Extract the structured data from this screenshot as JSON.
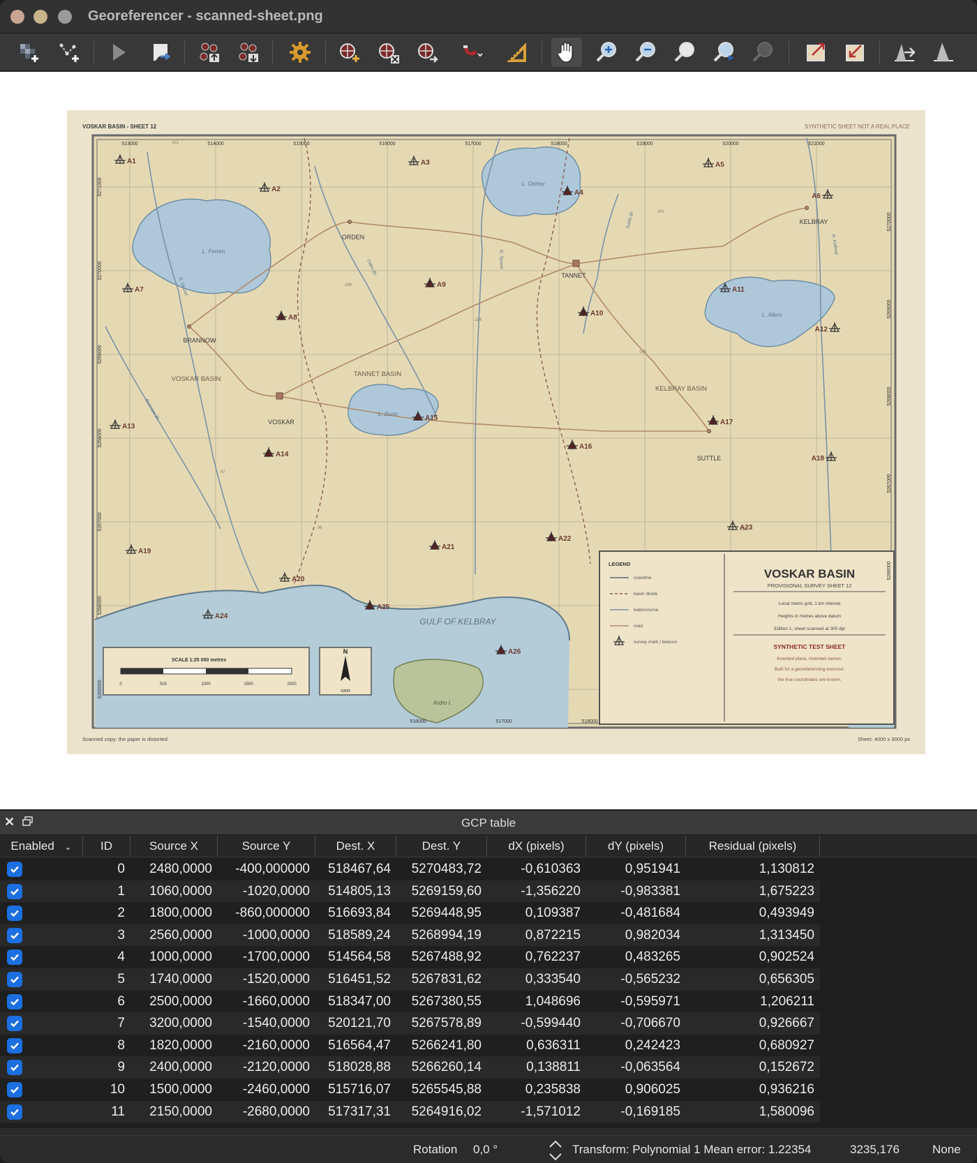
{
  "window": {
    "title": "Georeferencer - scanned-sheet.png"
  },
  "toolbar": {
    "tools": [
      {
        "name": "open-raster-icon"
      },
      {
        "name": "start-georef-icon"
      },
      {
        "name": "run-icon"
      },
      {
        "name": "generate-script-icon"
      },
      {
        "name": "load-gcp-icon"
      },
      {
        "name": "save-gcp-icon"
      },
      {
        "name": "settings-icon"
      },
      {
        "name": "add-point-icon"
      },
      {
        "name": "delete-point-icon"
      },
      {
        "name": "move-point-icon"
      },
      {
        "name": "snap-icon"
      },
      {
        "name": "transform-settings-icon"
      },
      {
        "name": "pan-icon"
      },
      {
        "name": "zoom-in-icon"
      },
      {
        "name": "zoom-out-icon"
      },
      {
        "name": "zoom-layer-icon"
      },
      {
        "name": "zoom-last-icon"
      },
      {
        "name": "zoom-next-icon"
      },
      {
        "name": "link-georef-icon"
      },
      {
        "name": "link-qgis-icon"
      },
      {
        "name": "full-histogram-icon"
      },
      {
        "name": "local-histogram-icon"
      }
    ]
  },
  "map": {
    "header_left": "VOSKAR BASIN - SHEET 12",
    "header_right": "SYNTHETIC SHEET   NOT A REAL PLACE",
    "footer_left": "Scanned copy; the paper is distorted.",
    "footer_right": "Sheet: 4000 x 3000 px",
    "top_ticks": [
      "513000",
      "514000",
      "515000",
      "516000",
      "517000",
      "518000",
      "519000",
      "520000",
      "521000"
    ],
    "left_ticks": [
      "5271000",
      "5270000",
      "5269000",
      "5268000",
      "5267000",
      "5266000",
      "5265000"
    ],
    "right_ticks": [
      "5270000",
      "5269000",
      "5268000",
      "5267000",
      "5266000"
    ],
    "bottom_ticks": [
      "516000",
      "517000",
      "518000"
    ],
    "lakes": [
      "L. Ferren",
      "L. Ostrey",
      "L. Dunn",
      "L. Aliers"
    ],
    "island": "Ardro I.",
    "gulf": "GULF OF KELBRAY",
    "streams": [
      "R. Vessel",
      "Oden Br.",
      "R. Tannet",
      "Suttle Br.",
      "R. Kelbray",
      "Brannow Br."
    ],
    "places": [
      "ORDEN",
      "TANNET",
      "KELBRAY",
      "BRANNOW",
      "VOSKAR",
      "SUTTLE"
    ],
    "basins": [
      "VOSKAR BASIN",
      "TANNET BASIN",
      "KELBRAY BASIN"
    ],
    "heights": [
      "412",
      "288",
      "224",
      "341",
      "163",
      "47",
      "96",
      "138"
    ],
    "points": [
      "A1",
      "A2",
      "A3",
      "A4",
      "A5",
      "A6",
      "A7",
      "A8",
      "A9",
      "A10",
      "A11",
      "A12",
      "A13",
      "A14",
      "A15",
      "A16",
      "A17",
      "A18",
      "A19",
      "A20",
      "A21",
      "A22",
      "A23",
      "A24",
      "A25",
      "A26"
    ],
    "scale_title": "SCALE 1:25 000    metres",
    "scale_ticks": [
      "0",
      "500",
      "1000",
      "1500",
      "2000"
    ],
    "north_label": "N",
    "north_sub": "GRID",
    "legend_title": "LEGEND",
    "legend_items": [
      "coastline",
      "basin divide",
      "watercourse",
      "road",
      "survey mark / beacon"
    ],
    "sheet_title": "VOSKAR BASIN",
    "sheet_sub": "PROVISIONAL SURVEY SHEET 12",
    "notes": [
      "Local metric grid, 1 km interval",
      "Heights in metres above datum",
      "Edition 1, sheet scanned at 300 dpi"
    ],
    "synthetic_title": "SYNTHETIC TEST SHEET",
    "synthetic_notes": [
      "Invented place, invented names.",
      "Built for a georeferencing exercise;",
      "the true coordinates are known."
    ]
  },
  "panel": {
    "title": "GCP table"
  },
  "table": {
    "headers": [
      "Enabled",
      "ID",
      "Source X",
      "Source Y",
      "Dest. X",
      "Dest. Y",
      "dX (pixels)",
      "dY (pixels)",
      "Residual (pixels)"
    ],
    "rows": [
      {
        "id": "0",
        "sx": "2480,0000",
        "sy": "-400,000000",
        "dx": "518467,64",
        "dy": "5270483,72",
        "ex": "-0,610363",
        "ey": "0,951941",
        "res": "1,130812"
      },
      {
        "id": "1",
        "sx": "1060,0000",
        "sy": "-1020,0000",
        "dx": "514805,13",
        "dy": "5269159,60",
        "ex": "-1,356220",
        "ey": "-0,983381",
        "res": "1,675223"
      },
      {
        "id": "2",
        "sx": "1800,0000",
        "sy": "-860,000000",
        "dx": "516693,84",
        "dy": "5269448,95",
        "ex": "0,109387",
        "ey": "-0,481684",
        "res": "0,493949"
      },
      {
        "id": "3",
        "sx": "2560,0000",
        "sy": "-1000,0000",
        "dx": "518589,24",
        "dy": "5268994,19",
        "ex": "0,872215",
        "ey": "0,982034",
        "res": "1,313450"
      },
      {
        "id": "4",
        "sx": "1000,0000",
        "sy": "-1700,0000",
        "dx": "514564,58",
        "dy": "5267488,92",
        "ex": "0,762237",
        "ey": "0,483265",
        "res": "0,902524"
      },
      {
        "id": "5",
        "sx": "1740,0000",
        "sy": "-1520,0000",
        "dx": "516451,52",
        "dy": "5267831,62",
        "ex": "0,333540",
        "ey": "-0,565232",
        "res": "0,656305"
      },
      {
        "id": "6",
        "sx": "2500,0000",
        "sy": "-1660,0000",
        "dx": "518347,00",
        "dy": "5267380,55",
        "ex": "1,048696",
        "ey": "-0,595971",
        "res": "1,206211"
      },
      {
        "id": "7",
        "sx": "3200,0000",
        "sy": "-1540,0000",
        "dx": "520121,70",
        "dy": "5267578,89",
        "ex": "-0,599440",
        "ey": "-0,706670",
        "res": "0,926667"
      },
      {
        "id": "8",
        "sx": "1820,0000",
        "sy": "-2160,0000",
        "dx": "516564,47",
        "dy": "5266241,80",
        "ex": "0,636311",
        "ey": "0,242423",
        "res": "0,680927"
      },
      {
        "id": "9",
        "sx": "2400,0000",
        "sy": "-2120,0000",
        "dx": "518028,88",
        "dy": "5266260,14",
        "ex": "0,138811",
        "ey": "-0,063564",
        "res": "0,152672"
      },
      {
        "id": "10",
        "sx": "1500,0000",
        "sy": "-2460,0000",
        "dx": "515716,07",
        "dy": "5265545,88",
        "ex": "0,235838",
        "ey": "0,906025",
        "res": "0,936216"
      },
      {
        "id": "11",
        "sx": "2150,0000",
        "sy": "-2680,0000",
        "dx": "517317,31",
        "dy": "5264916,02",
        "ex": "-1,571012",
        "ey": "-0,169185",
        "res": "1,580096"
      }
    ]
  },
  "status": {
    "rotation_label": "Rotation",
    "rotation_value": "0,0 °",
    "transform": "Transform: Polynomial 1 Mean error: 1.22354",
    "coords": "3235,176",
    "crs": "None"
  }
}
